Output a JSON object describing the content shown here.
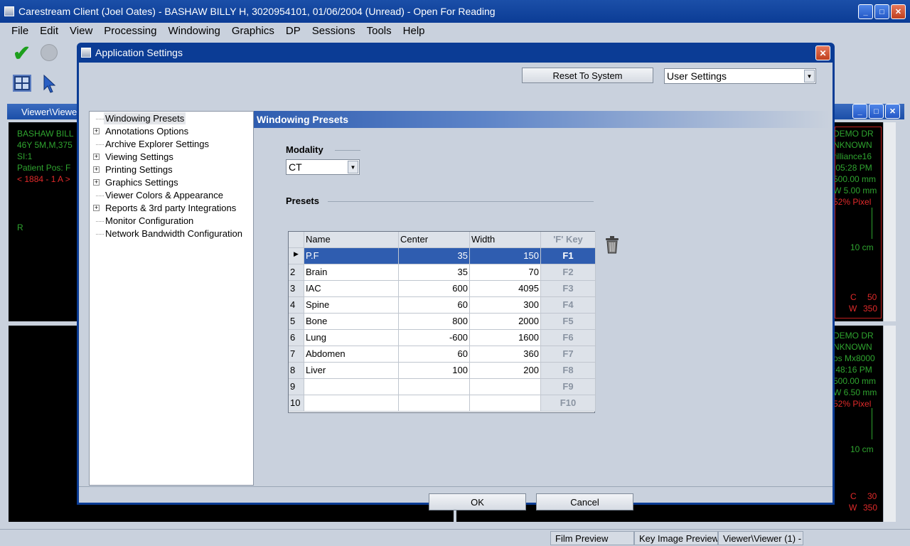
{
  "app": {
    "title": "Carestream Client (Joel Oates) - BASHAW BILLY H, 3020954101, 01/06/2004 (Unread) - Open For Reading"
  },
  "menu": [
    "File",
    "Edit",
    "View",
    "Processing",
    "Windowing",
    "Graphics",
    "DP",
    "Sessions",
    "Tools",
    "Help"
  ],
  "viewer": {
    "title": "Viewer\\Viewer",
    "top_left_overlay": [
      "BASHAW BILL",
      "46Y 5M,M,375",
      "SI:1",
      "Patient Pos: F"
    ],
    "top_left_red": "< 1884 - 1 A >",
    "top_left_marker": "R",
    "top_right_overlay": [
      "DEMO DR",
      "NKNOWN",
      "rilliance16",
      ":05:28 PM",
      "500.00 mm",
      "W 5.00 mm"
    ],
    "top_right_red": "52% Pixel",
    "top_right_scale": "10 cm",
    "top_right_c_label": "C",
    "top_right_c_value": "50",
    "top_right_w_label": "W",
    "top_right_w_value": "350",
    "bottom_right_overlay": [
      "DEMO DR",
      "NKNOWN",
      "os Mx8000",
      ":48:16 PM",
      "500.00 mm",
      "W 6.50 mm"
    ],
    "bottom_right_red": "52% Pixel",
    "bottom_right_scale": "10 cm",
    "bottom_right_c_label": "C",
    "bottom_right_c_value": "30",
    "bottom_right_w_label": "W",
    "bottom_right_w_value": "350"
  },
  "status_tabs": [
    "Film Preview",
    "Key Image Preview",
    "Viewer\\Viewer (1) -"
  ],
  "dialog": {
    "title": "Application Settings",
    "reset_button": "Reset To System",
    "settings_select": "User Settings",
    "tree": [
      {
        "label": "Windowing Presets",
        "expandable": false,
        "selected": true
      },
      {
        "label": "Annotations Options",
        "expandable": true,
        "selected": false
      },
      {
        "label": "Archive Explorer Settings",
        "expandable": false,
        "selected": false
      },
      {
        "label": "Viewing Settings",
        "expandable": true,
        "selected": false
      },
      {
        "label": "Printing Settings",
        "expandable": true,
        "selected": false
      },
      {
        "label": "Graphics Settings",
        "expandable": true,
        "selected": false
      },
      {
        "label": "Viewer Colors & Appearance",
        "expandable": false,
        "selected": false
      },
      {
        "label": "Reports & 3rd party Integrations",
        "expandable": true,
        "selected": false
      },
      {
        "label": "Monitor Configuration",
        "expandable": false,
        "selected": false
      },
      {
        "label": "Network Bandwidth Configuration",
        "expandable": false,
        "selected": false
      }
    ],
    "panel_title": "Windowing Presets",
    "modality_label": "Modality",
    "modality_value": "CT",
    "presets_label": "Presets",
    "presets_columns": [
      "Name",
      "Center",
      "Width",
      "'F' Key"
    ],
    "presets": [
      {
        "num": "",
        "name": "P.F",
        "center": "35",
        "width": "150",
        "fkey": "F1"
      },
      {
        "num": "2",
        "name": "Brain",
        "center": "35",
        "width": "70",
        "fkey": "F2"
      },
      {
        "num": "3",
        "name": "IAC",
        "center": "600",
        "width": "4095",
        "fkey": "F3"
      },
      {
        "num": "4",
        "name": "Spine",
        "center": "60",
        "width": "300",
        "fkey": "F4"
      },
      {
        "num": "5",
        "name": "Bone",
        "center": "800",
        "width": "2000",
        "fkey": "F5"
      },
      {
        "num": "6",
        "name": "Lung",
        "center": "-600",
        "width": "1600",
        "fkey": "F6"
      },
      {
        "num": "7",
        "name": "Abdomen",
        "center": "60",
        "width": "360",
        "fkey": "F7"
      },
      {
        "num": "8",
        "name": "Liver",
        "center": "100",
        "width": "200",
        "fkey": "F8"
      },
      {
        "num": "9",
        "name": "",
        "center": "",
        "width": "",
        "fkey": "F9"
      },
      {
        "num": "10",
        "name": "",
        "center": "",
        "width": "",
        "fkey": "F10"
      }
    ],
    "ok_button": "OK",
    "cancel_button": "Cancel"
  },
  "colors": {
    "titlebar": "#0b3c95",
    "selection": "#2f5db0",
    "accept_green": "#1d9f1d",
    "overlay_green": "#2fa42f",
    "overlay_red": "#e02a2a"
  }
}
